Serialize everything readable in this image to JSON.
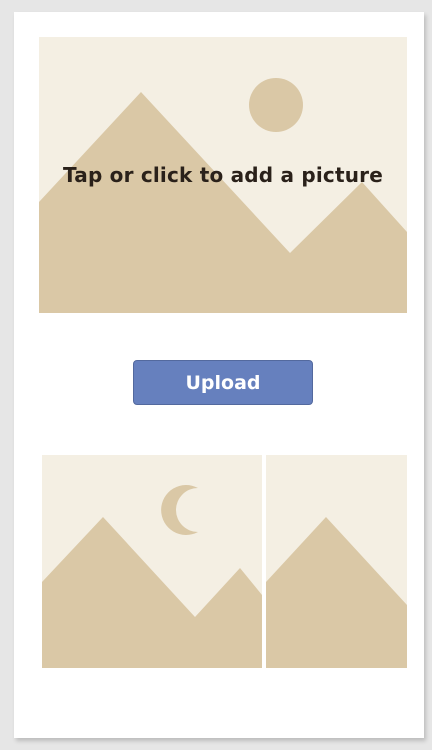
{
  "main": {
    "picture_prompt": "Tap or click to add a picture",
    "upload_label": "Upload"
  },
  "icons": {
    "hero": "image-placeholder-sun-mountains-icon",
    "thumb_1": "image-placeholder-moon-mountains-icon",
    "thumb_2": "image-placeholder-mountain-icon"
  },
  "colors": {
    "placeholder_sky": "#f4efe3",
    "placeholder_mountain": "#dac8a6",
    "button": "#6680be",
    "button_text": "#ffffff",
    "prompt_text": "#2a211a"
  }
}
